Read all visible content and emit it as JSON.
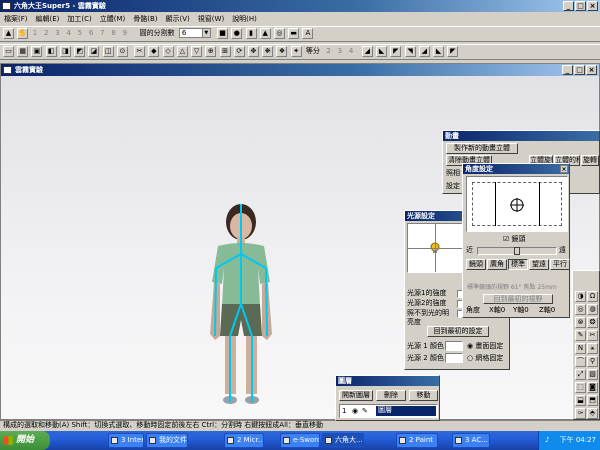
{
  "app": {
    "title": "六角大王Super5 - 雲霧實驗",
    "menu": [
      "檔案(F)",
      "編輯(E)",
      "加工(C)",
      "立體(M)",
      "骨骼(B)",
      "顯示(V)",
      "視窗(W)",
      "說明(H)"
    ]
  },
  "toolbar1": {
    "numbers": [
      "1",
      "2",
      "3",
      "4",
      "5",
      "6",
      "7",
      "8",
      "9"
    ],
    "divisions_label": "圓的分割數",
    "divisions_value": "6"
  },
  "toolbar2": {
    "equal_label": "等分",
    "numbers": [
      "2",
      "3",
      "4"
    ]
  },
  "document_window": {
    "title": "雲霧實驗"
  },
  "status_bar": {
    "text": "構成的選取和移動(A) Shift：切換式選取、移動時固定前後左右  Ctrl：分割時  右鍵按鈕成All：垂直移動"
  },
  "light_panel": {
    "title": "光源設定",
    "rows": [
      "光源1的強度",
      "光源2的強度",
      "照不到光的明亮度"
    ],
    "reset_button": "回到最初的設定",
    "color_rows": [
      "光源 1 顏色",
      "光源 2 顏色"
    ],
    "radio_screen": "畫面固定",
    "radio_grid": "網格固定"
  },
  "animation_panel": {
    "title": "動畫",
    "create_button": "製作新的動畫立體",
    "tab_a": "清除動畫立體",
    "tab_b": "立體旋轉",
    "tab_c": "立體的移動",
    "tab_d": "旋轉",
    "row_label_1": "照相",
    "row_label_2": "設定"
  },
  "camera_panel": {
    "title": "角度設定",
    "perspective_checkbox": "鏡頭",
    "near_label": "近",
    "far_label": "遠",
    "lens_buttons": [
      "鏡頭",
      "廣角",
      "標準",
      "望遠",
      "平行"
    ],
    "lens_info": "標準鏡頭的視野 61°  焦點 25mm",
    "reset_button": "回到最初的視野",
    "angle_label": "角度",
    "x_label": "X軸0",
    "y_label": "Y軸0",
    "z_label": "Z軸0"
  },
  "layer_panel": {
    "title": "圖層",
    "buttons": [
      "開新圖層",
      "刪除",
      "移動"
    ],
    "row_index": "1",
    "row_name": "圖層"
  },
  "taskbar": {
    "start": "開始",
    "tasks": [
      "3 Inter...",
      "我的文件",
      "2 Micr...",
      "e-Sword...",
      "六角大...",
      "2 Paint",
      "3 AC..."
    ],
    "clock": "下午 04:27"
  },
  "colors": {
    "accent": "#0a246a",
    "viewport_top": "#e6e6ea",
    "viewport_bottom": "#f7f7f7",
    "bone": "#00c8f0"
  }
}
